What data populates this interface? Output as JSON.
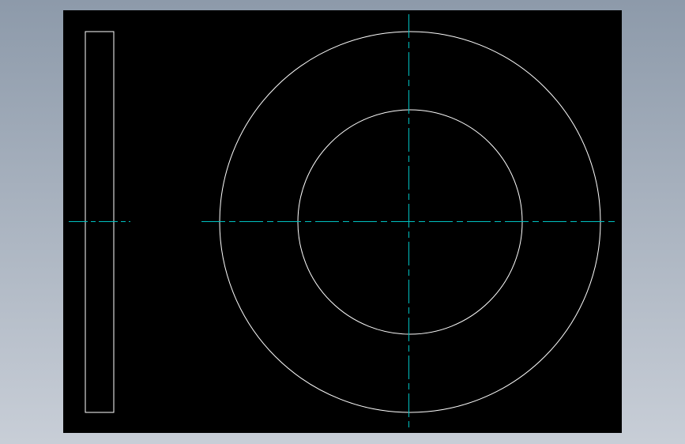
{
  "background": {
    "gradient_top": "#8d9aaa",
    "gradient_bottom": "#c8ced7"
  },
  "drawing": {
    "canvas_color": "#000000",
    "geometry_color": "#ffffff",
    "centerline_color": "#00c0c0",
    "views": [
      {
        "name": "side-view",
        "shape": "rectangle"
      },
      {
        "name": "front-view",
        "shape": "concentric-circles",
        "ring_count": 2
      }
    ]
  }
}
